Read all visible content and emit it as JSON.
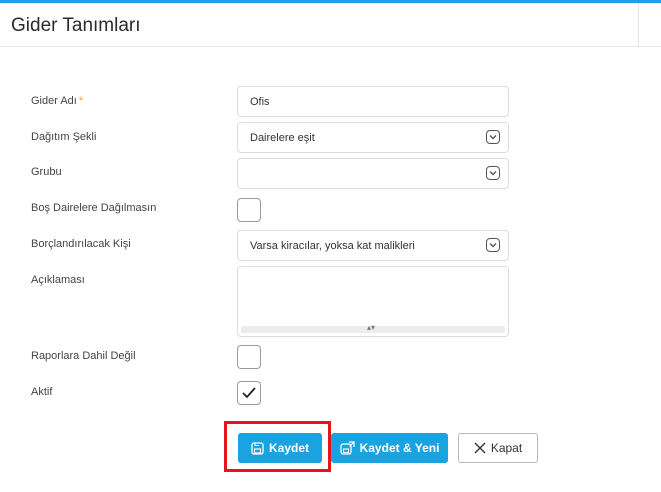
{
  "header": {
    "title": "Gider Tanımları"
  },
  "form": {
    "gider_adi": {
      "label": "Gider Adı",
      "required_mark": "*",
      "value": "Ofis"
    },
    "dagitim_sekli": {
      "label": "Dağıtım Şekli",
      "value": "Dairelere eşit"
    },
    "grubu": {
      "label": "Grubu",
      "value": ""
    },
    "bos_daireler": {
      "label": "Boş Dairelere Dağılmasın",
      "checked": false
    },
    "borclandirilacak": {
      "label": "Borçlandırılacak Kişi",
      "value": "Varsa kiracılar, yoksa kat malikleri"
    },
    "aciklamasi": {
      "label": "Açıklaması",
      "value": ""
    },
    "raporlara_dahil_degil": {
      "label": "Raporlara Dahil Değil",
      "checked": false
    },
    "aktif": {
      "label": "Aktif",
      "checked": true
    }
  },
  "buttons": {
    "save": "Kaydet",
    "save_new": "Kaydet & Yeni",
    "close": "Kapat"
  },
  "colors": {
    "accent": "#1aa3e1",
    "highlight": "#e8141b",
    "required": "#f0a020"
  }
}
